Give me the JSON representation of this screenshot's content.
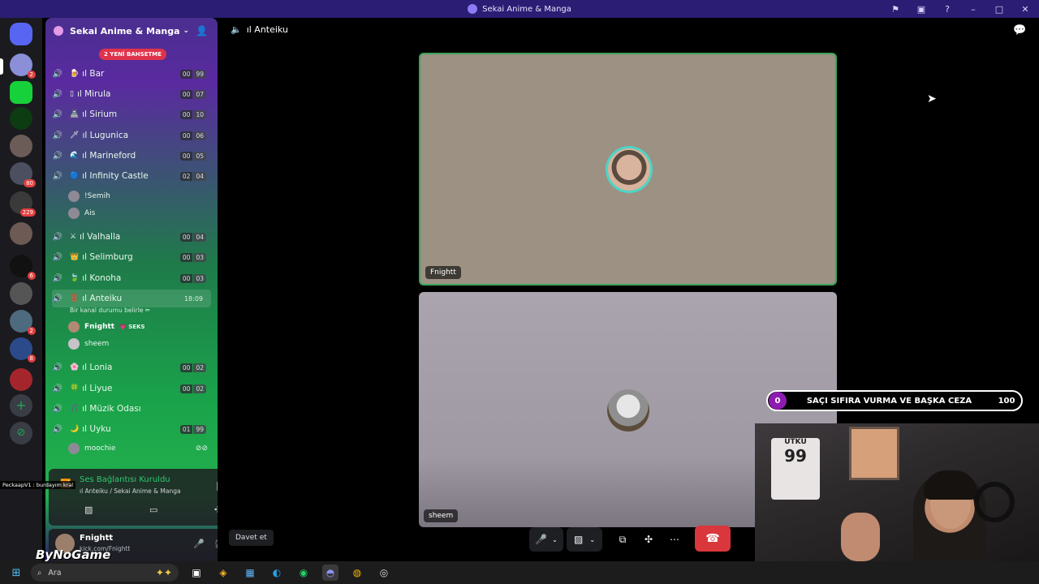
{
  "window": {
    "title": "Sekai Anime & Manga",
    "controls": [
      "⚑",
      "▣",
      "?",
      "–",
      "□",
      "✕"
    ]
  },
  "server": {
    "name": "Sekai Anime & Manga",
    "mention_pill": "2 YENİ BAHSETME",
    "badges": [
      "2",
      "80",
      "229",
      "6",
      "2",
      "8"
    ]
  },
  "channels": [
    {
      "name": "ıl Bar",
      "emoji": "🍺",
      "lim_a": "00",
      "lim_b": "99"
    },
    {
      "name": "ıl Mirula",
      "emoji": "▯",
      "lim_a": "00",
      "lim_b": "07"
    },
    {
      "name": "ıl Sirium",
      "emoji": "🏯",
      "lim_a": "00",
      "lim_b": "10"
    },
    {
      "name": "ıl Lugunica",
      "emoji": "🗡",
      "lim_a": "00",
      "lim_b": "06"
    },
    {
      "name": "ıl Marineford",
      "emoji": "🌊",
      "lim_a": "00",
      "lim_b": "05"
    },
    {
      "name": "ıl Infinity Castle",
      "emoji": "🔵",
      "lim_a": "02",
      "lim_b": "04"
    },
    {
      "name": "ıl Valhalla",
      "emoji": "⚔",
      "lim_a": "00",
      "lim_b": "04"
    },
    {
      "name": "ıl Selimburg",
      "emoji": "👑",
      "lim_a": "00",
      "lim_b": "03"
    },
    {
      "name": "ıl Konoha",
      "emoji": "🍃",
      "lim_a": "00",
      "lim_b": "03"
    },
    {
      "name": "ıl Anteiku",
      "emoji": "🚪",
      "time": "18:09"
    },
    {
      "name": "ıl Lonia",
      "emoji": "🌸",
      "lim_a": "00",
      "lim_b": "02"
    },
    {
      "name": "ıl Liyue",
      "emoji": "🍀",
      "lim_a": "00",
      "lim_b": "02"
    },
    {
      "name": "ıl Müzik Odası",
      "emoji": "🎵"
    },
    {
      "name": "ıl Uyku",
      "emoji": "🌙",
      "lim_a": "01",
      "lim_b": "99"
    }
  ],
  "members": {
    "infinity": [
      "!Semih",
      "Ais"
    ],
    "anteiku": [
      "Fnightt",
      "sheem"
    ],
    "anteiku_tag": "💗 SEKS",
    "uyku": [
      "moochie"
    ]
  },
  "anteiku_status": "Bir kanal durumu belirle ✏",
  "voice_panel": {
    "title": "Ses Bağlantısı Kuruldu",
    "sub": "ıl Anteiku / Sekai Anime & Manga",
    "overlay": "PeckaapV1 : burdayım kral"
  },
  "user_panel": {
    "name": "Fnightt",
    "sub": "kick.com/Fnightt"
  },
  "main": {
    "channel": "ıl Anteiku",
    "tile1_name": "Fnightt",
    "tile2_name": "sheem",
    "invite": "Davet et"
  },
  "overlay_bar": {
    "left": "0",
    "text": "SAÇI SIFIRA VURMA VE BAŞKA CEZA",
    "right": "100"
  },
  "webcam": {
    "shirt_name": "UTKU",
    "shirt_num": "99"
  },
  "watermark": "ByNoGame",
  "taskbar": {
    "search": "Ara"
  }
}
